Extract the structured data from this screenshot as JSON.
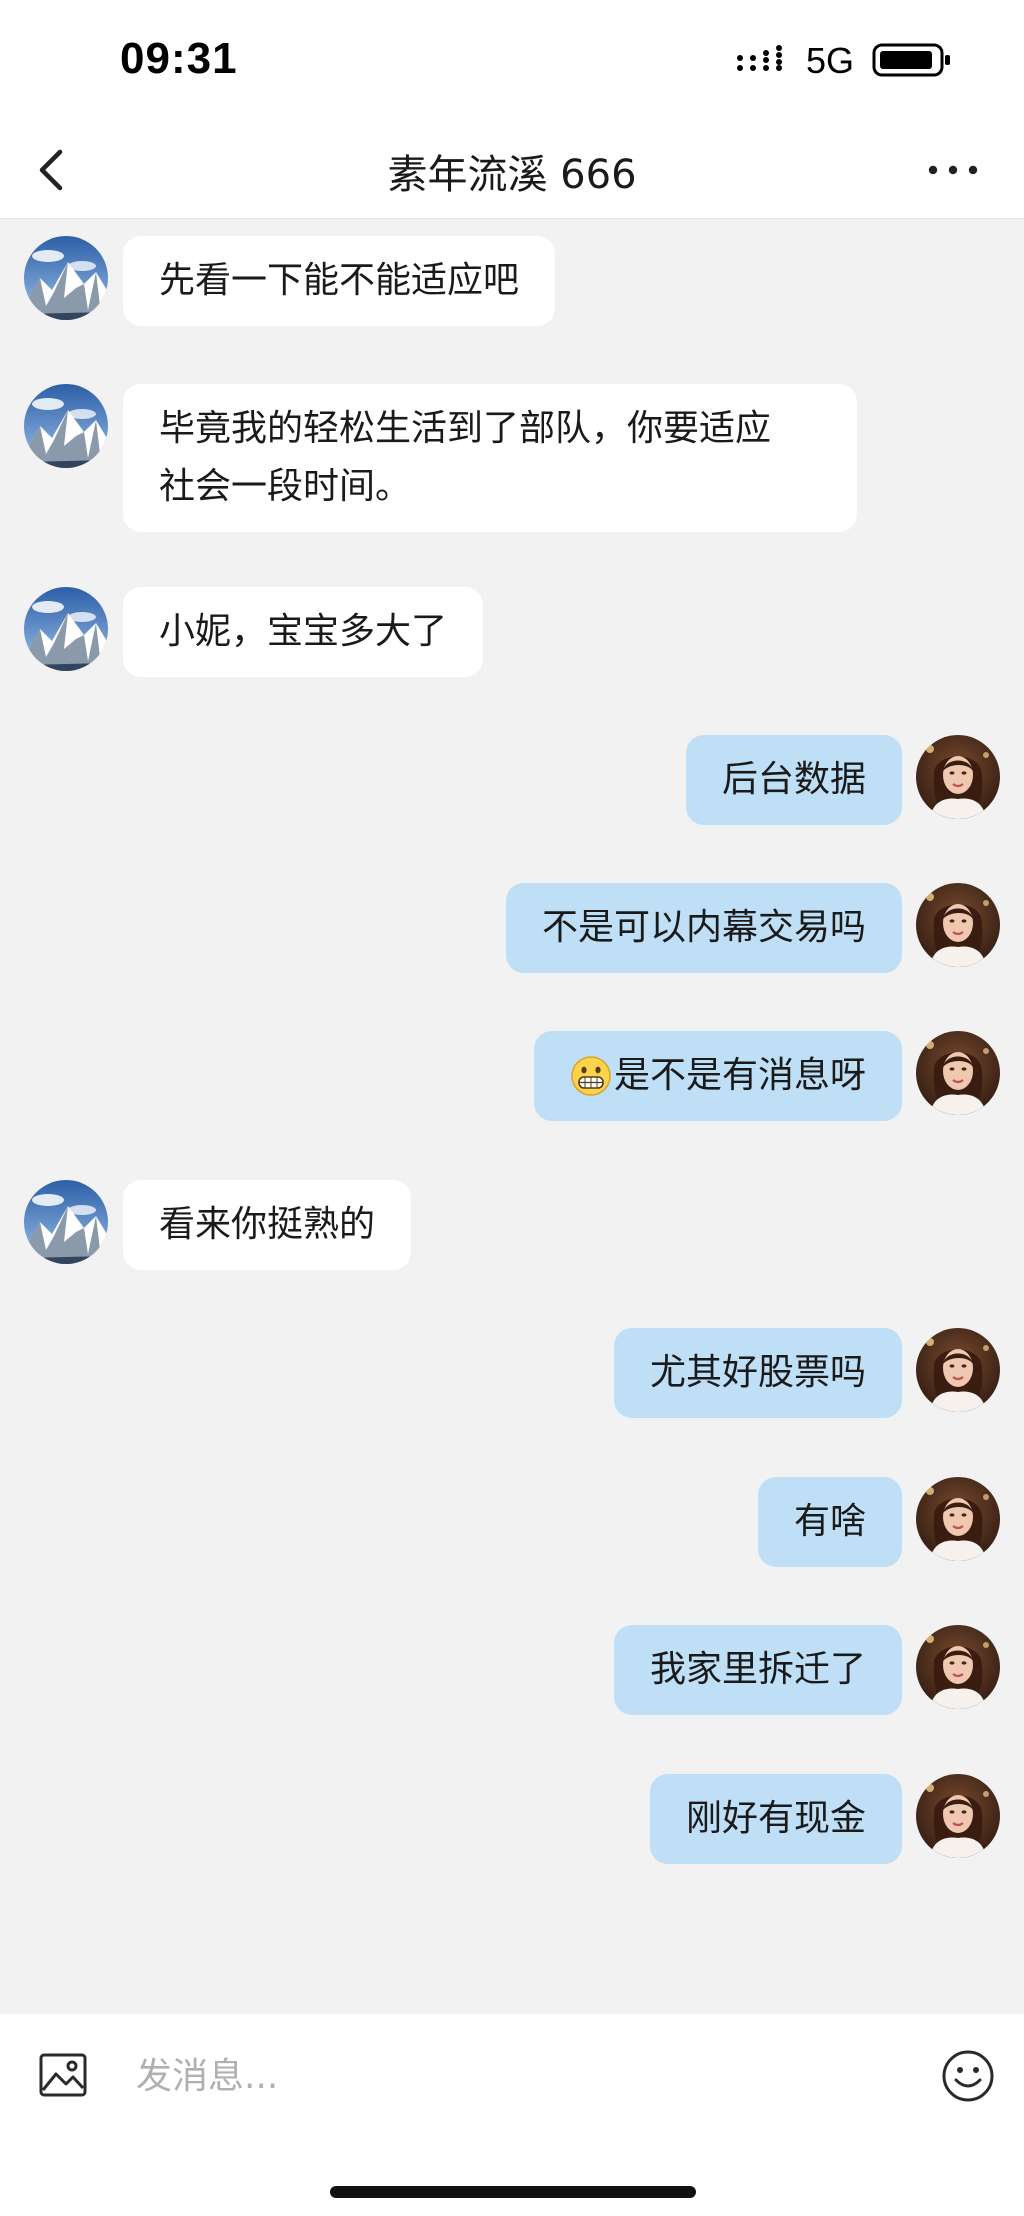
{
  "status_bar": {
    "time": "09:31",
    "network": "5G"
  },
  "header": {
    "title": "素年流溪 666"
  },
  "messages": [
    {
      "side": "left",
      "text": "先看一下能不能适应吧"
    },
    {
      "side": "left",
      "lines": [
        "毕竟我的轻松生活到了部队，你要适应",
        "社会一段时间。"
      ]
    },
    {
      "side": "left",
      "text": "小妮，宝宝多大了"
    },
    {
      "side": "right",
      "text": "后台数据"
    },
    {
      "side": "right",
      "text": "不是可以内幕交易吗"
    },
    {
      "side": "right",
      "emoji": "grin-emoji",
      "text": "是不是有消息呀"
    },
    {
      "side": "left",
      "text": "看来你挺熟的"
    },
    {
      "side": "right",
      "text": "尤其好股票吗"
    },
    {
      "side": "right",
      "text": "有啥"
    },
    {
      "side": "right",
      "text": "我家里拆迁了"
    },
    {
      "side": "right",
      "text": "刚好有现金"
    }
  ],
  "input_bar": {
    "placeholder": "发消息..."
  },
  "icons": {
    "back": "chevron-left-icon",
    "more": "more-horizontal-icon",
    "image": "image-icon",
    "emoji": "smiley-icon"
  },
  "colors": {
    "background": "#f2f2f2",
    "outgoing_bubble": "#bedff6",
    "incoming_bubble": "#ffffff"
  }
}
